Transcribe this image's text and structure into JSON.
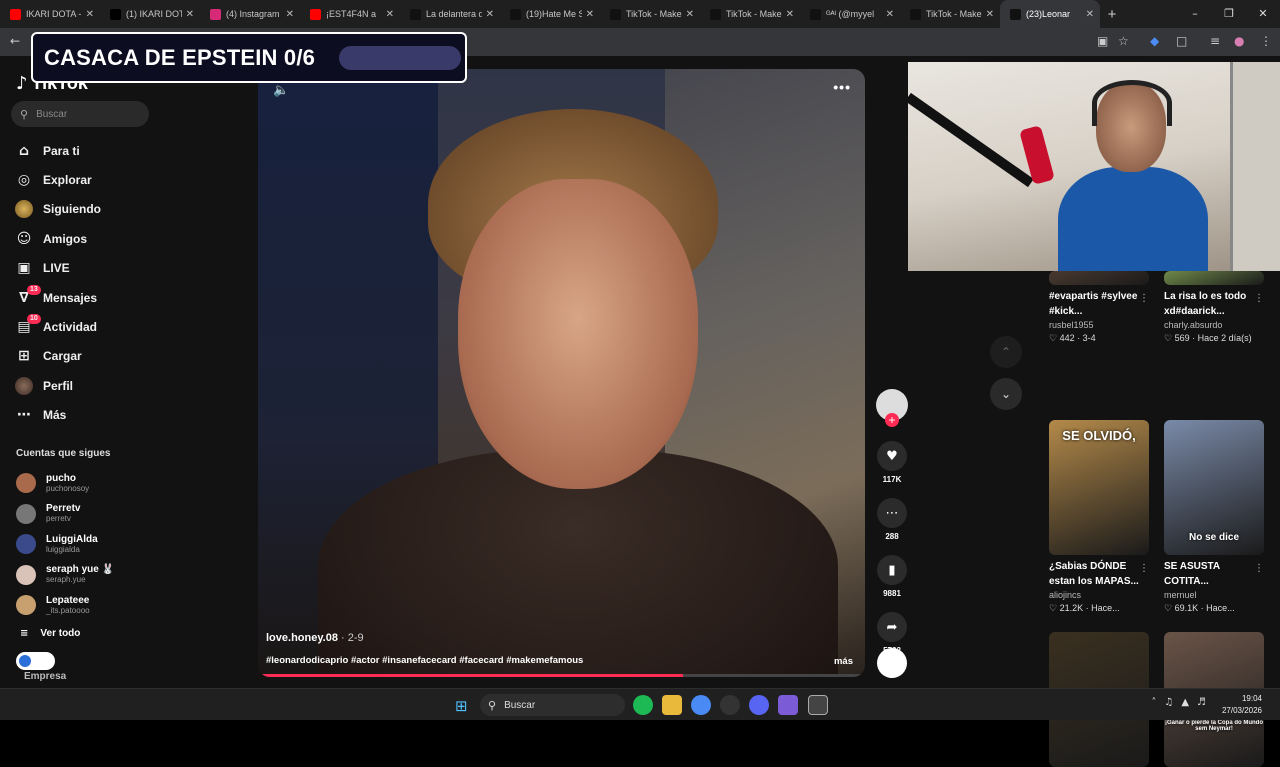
{
  "browser": {
    "tabs": [
      {
        "title": "IKARI DOTA - •",
        "favicon": "youtube",
        "color": "#ff0000"
      },
      {
        "title": "(1) IKARI DOTA",
        "favicon": "x",
        "color": "#000000"
      },
      {
        "title": "(4) Instagram",
        "favicon": "instagram",
        "color": "#d62976"
      },
      {
        "title": "¡EST4F4N a",
        "favicon": "youtube",
        "color": "#ff0000"
      },
      {
        "title": "La delantera d",
        "favicon": "tiktok",
        "color": "#111111"
      },
      {
        "title": "(19)Hate Me S",
        "favicon": "tiktok",
        "color": "#111111"
      },
      {
        "title": "TikTok - Make",
        "favicon": "tiktok",
        "color": "#111111"
      },
      {
        "title": "TikTok - Make",
        "favicon": "tiktok",
        "color": "#111111"
      },
      {
        "title": "ᴳᴬᴵ (@myyel",
        "favicon": "tiktok",
        "color": "#111111"
      },
      {
        "title": "TikTok - Make",
        "favicon": "tiktok",
        "color": "#111111"
      },
      {
        "title": "(23)Leonar",
        "favicon": "tiktok",
        "color": "#111111",
        "active": true
      }
    ]
  },
  "overlay": {
    "title": "CASACA DE EPSTEIN 0/6"
  },
  "sidebar": {
    "logo": "TikTok",
    "search_placeholder": "Buscar",
    "nav": [
      {
        "label": "Para ti",
        "icon": "home-icon",
        "glyph": "⌂"
      },
      {
        "label": "Explorar",
        "icon": "compass-icon",
        "glyph": "◎"
      },
      {
        "label": "Siguiendo",
        "icon": "following-avatar-icon",
        "glyph": ""
      },
      {
        "label": "Amigos",
        "icon": "friends-icon",
        "glyph": "☺"
      },
      {
        "label": "LIVE",
        "icon": "live-icon",
        "glyph": "▣"
      },
      {
        "label": "Mensajes",
        "icon": "messages-icon",
        "glyph": "∇",
        "badge": "13"
      },
      {
        "label": "Actividad",
        "icon": "activity-icon",
        "glyph": "▤",
        "badge": "10"
      },
      {
        "label": "Cargar",
        "icon": "upload-icon",
        "glyph": "⊞"
      },
      {
        "label": "Perfil",
        "icon": "profile-avatar-icon",
        "glyph": "●"
      },
      {
        "label": "Más",
        "icon": "more-icon",
        "glyph": "⋯"
      }
    ],
    "following_header": "Cuentas que sigues",
    "following": [
      {
        "name": "pucho",
        "handle": "puchonosoy",
        "color": "#a86a4a"
      },
      {
        "name": "Perretv",
        "handle": "perretv",
        "color": "#777777"
      },
      {
        "name": "LuiggiAlda",
        "handle": "luiggialda",
        "color": "#3a4a8a"
      },
      {
        "name": "seraph yue 🐰",
        "handle": "seraph.yue",
        "color": "#d9c2b8"
      },
      {
        "name": "Lepateee",
        "handle": "_its.patoooo",
        "color": "#c8a070"
      }
    ],
    "see_all": "Ver todo",
    "business": "Empresa"
  },
  "video": {
    "username": "love.honey.08",
    "date": "2-9",
    "hashtags": "#leonardodicaprio #actor #insanefacecard #facecard #makemefamous",
    "more": "más",
    "progress": 0.7,
    "likes": "117K",
    "comments": "288",
    "saves": "9881",
    "shares": "5722"
  },
  "recommendations": [
    {
      "title": "#evapartis #sylvee #kick...",
      "user": "rusbel1955",
      "likes": "442",
      "extra": "3-4",
      "thumb": "#4a3a30",
      "caption": ""
    },
    {
      "title": "La risa lo es todo xd#daarick...",
      "user": "charly.absurdo",
      "likes": "569",
      "extra": "Hace 2 día(s)",
      "thumb": "#6f8a4a",
      "caption": ""
    },
    {
      "title": "¿Sabias DÓNDE estan los MAPAS...",
      "user": "aliojincs",
      "likes": "21.2K",
      "extra": "Hace...",
      "thumb": "#b48a4a",
      "caption": "SE OLVIDÓ,"
    },
    {
      "title": "SE ASUSTA COTITA...",
      "user": "mernuel",
      "likes": "69.1K",
      "extra": "Hace...",
      "thumb": "#7a8aa8",
      "caption": "No se dice"
    },
    {
      "title": "",
      "user": "",
      "likes": "",
      "extra": "",
      "thumb": "#3a3020",
      "caption": ""
    },
    {
      "title": "",
      "user": "",
      "likes": "",
      "extra": "",
      "thumb": "#6a5448",
      "caption": "¡Ganar o pierde la Copa do Mundo sem Neymar!"
    }
  ],
  "taskbar": {
    "search": "Buscar",
    "time": "19:04",
    "date": "27/03/2026"
  }
}
